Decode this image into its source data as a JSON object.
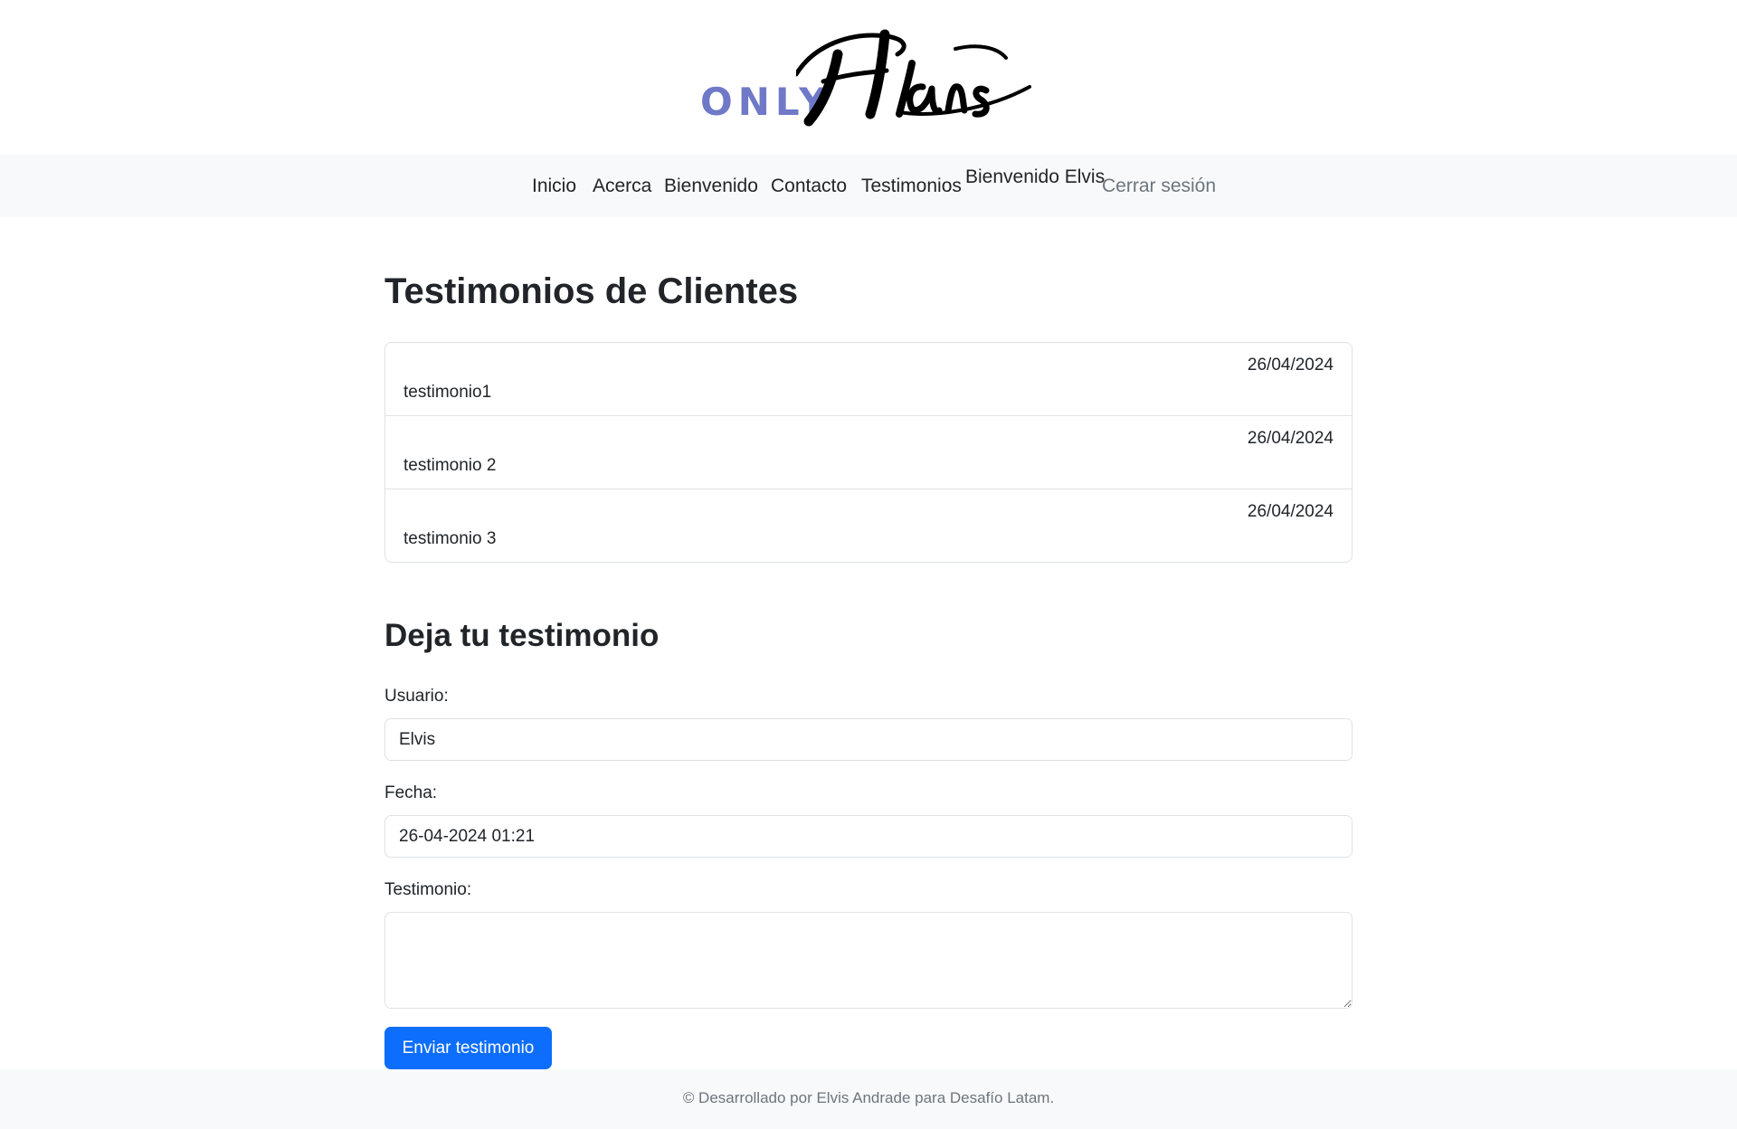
{
  "brand": {
    "prefix": "ONLY",
    "name": "Flans",
    "prefix_color": "#6f79c7"
  },
  "nav": {
    "links": [
      "Inicio",
      "Acerca",
      "Bienvenido",
      "Contacto",
      "Testimonios"
    ],
    "welcome": "Bienvenido Elvis",
    "logout": "Cerrar sesión"
  },
  "testimonials": {
    "title": "Testimonios de Clientes",
    "items": [
      {
        "date": "26/04/2024",
        "text": "testimonio1"
      },
      {
        "date": "26/04/2024",
        "text": "testimonio 2"
      },
      {
        "date": "26/04/2024",
        "text": "testimonio 3"
      }
    ]
  },
  "form": {
    "title": "Deja tu testimonio",
    "user_label": "Usuario:",
    "user_value": "Elvis",
    "date_label": "Fecha:",
    "date_value": "26-04-2024 01:21",
    "text_label": "Testimonio:",
    "text_value": "",
    "submit": "Enviar testimonio",
    "button_color": "#0d6efd"
  },
  "footer": {
    "text": "© Desarrollado por Elvis Andrade para Desafío Latam."
  }
}
